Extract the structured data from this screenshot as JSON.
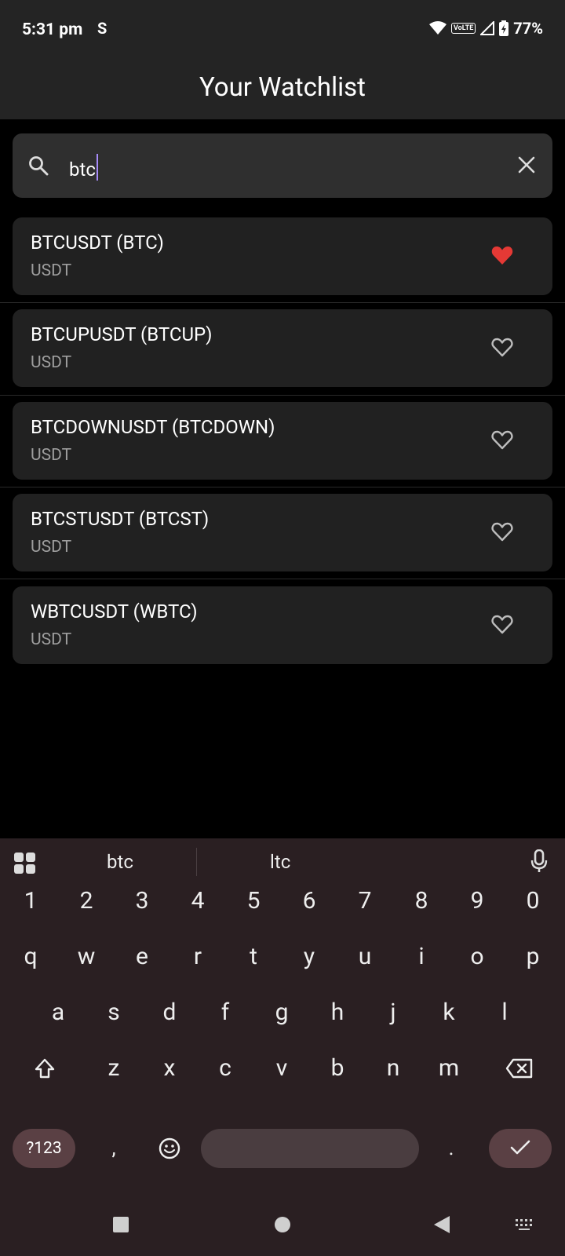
{
  "status_bar": {
    "time": "5:31 pm",
    "s_icon": "S",
    "network": "VoLTE",
    "battery": "77%"
  },
  "app_bar": {
    "title": "Your Watchlist"
  },
  "search": {
    "value": "btc"
  },
  "results": [
    {
      "title": "BTCUSDT (BTC)",
      "quote": "USDT",
      "favorited": true
    },
    {
      "title": "BTCUPUSDT (BTCUP)",
      "quote": "USDT",
      "favorited": false
    },
    {
      "title": "BTCDOWNUSDT (BTCDOWN)",
      "quote": "USDT",
      "favorited": false
    },
    {
      "title": "BTCSTUSDT (BTCST)",
      "quote": "USDT",
      "favorited": false
    },
    {
      "title": "WBTCUSDT (WBTC)",
      "quote": "USDT",
      "favorited": false
    }
  ],
  "keyboard": {
    "suggestions": [
      "btc",
      "ltc"
    ],
    "row_numbers": [
      "1",
      "2",
      "3",
      "4",
      "5",
      "6",
      "7",
      "8",
      "9",
      "0"
    ],
    "row_top": [
      "q",
      "w",
      "e",
      "r",
      "t",
      "y",
      "u",
      "i",
      "o",
      "p"
    ],
    "row_home": [
      "a",
      "s",
      "d",
      "f",
      "g",
      "h",
      "j",
      "k",
      "l"
    ],
    "row_bottom": [
      "z",
      "x",
      "c",
      "v",
      "b",
      "n",
      "m"
    ],
    "symbols_label": "?123",
    "comma": ",",
    "period": "."
  },
  "colors": {
    "favorite": "#e53935",
    "unfavorite": "#bdbdbd",
    "accent": "#a78bfa"
  }
}
